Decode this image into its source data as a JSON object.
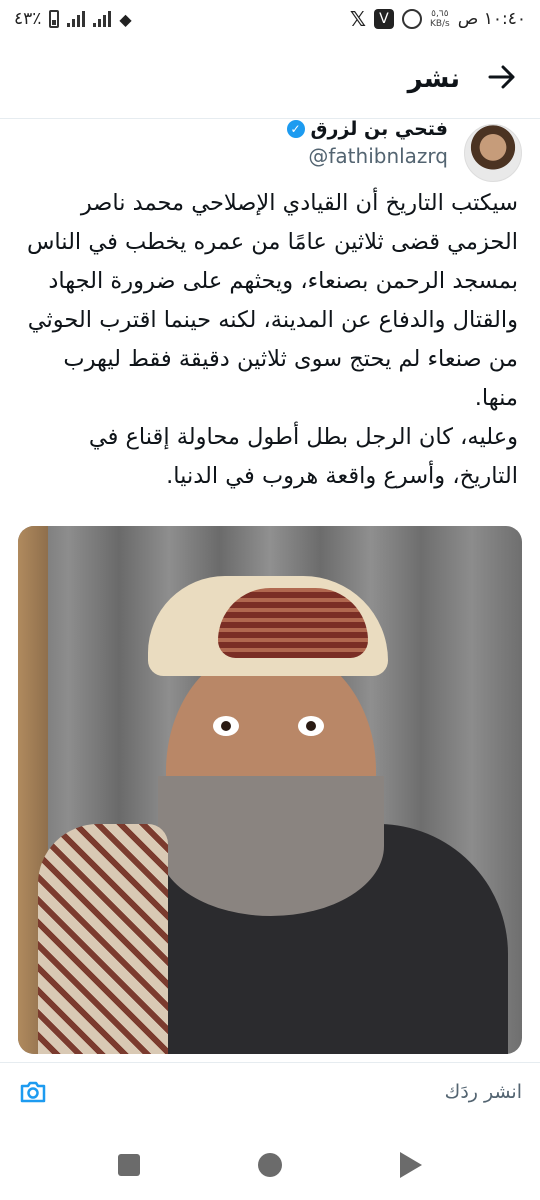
{
  "status_bar": {
    "battery_percent": "٤٣٪",
    "speed_value": "٥,٦٥",
    "speed_unit": "KB/s",
    "time": "١٠:٤٠ ص",
    "icons": [
      "battery-icon",
      "signal-icon",
      "signal-icon",
      "wifi-icon",
      "x-app-icon",
      "v-app-icon",
      "whatsapp-icon"
    ]
  },
  "header": {
    "title": "نشر",
    "back_icon": "arrow-right-icon"
  },
  "tweet": {
    "display_name": "فتحي بن لزرق",
    "handle": "@fathibnlazrq",
    "verified_icon": "verified-badge-icon",
    "paragraph_1": "سيكتب التاريخ أن القيادي الإصلاحي محمد ناصر الحزمي قضى ثلاثين عامًا من عمره يخطب في الناس بمسجد الرحمن بصنعاء، ويحثهم على ضرورة الجهاد والقتال والدفاع عن المدينة، لكنه حينما اقترب الحوثي من صنعاء لم يحتج سوى ثلاثين دقيقة فقط ليهرب منها.",
    "paragraph_2": "وعليه، كان الرجل بطل أطول محاولة إقناع في التاريخ، وأسرع واقعة هروب في الدنيا."
  },
  "reply": {
    "placeholder": "انشر ردَك",
    "camera_icon": "camera-icon"
  },
  "nav_bar": {
    "icons": [
      "recents-icon",
      "home-icon",
      "back-icon"
    ]
  },
  "colors": {
    "accent": "#1d9bf0",
    "secondary_text": "#536471",
    "text": "#0f1419"
  }
}
